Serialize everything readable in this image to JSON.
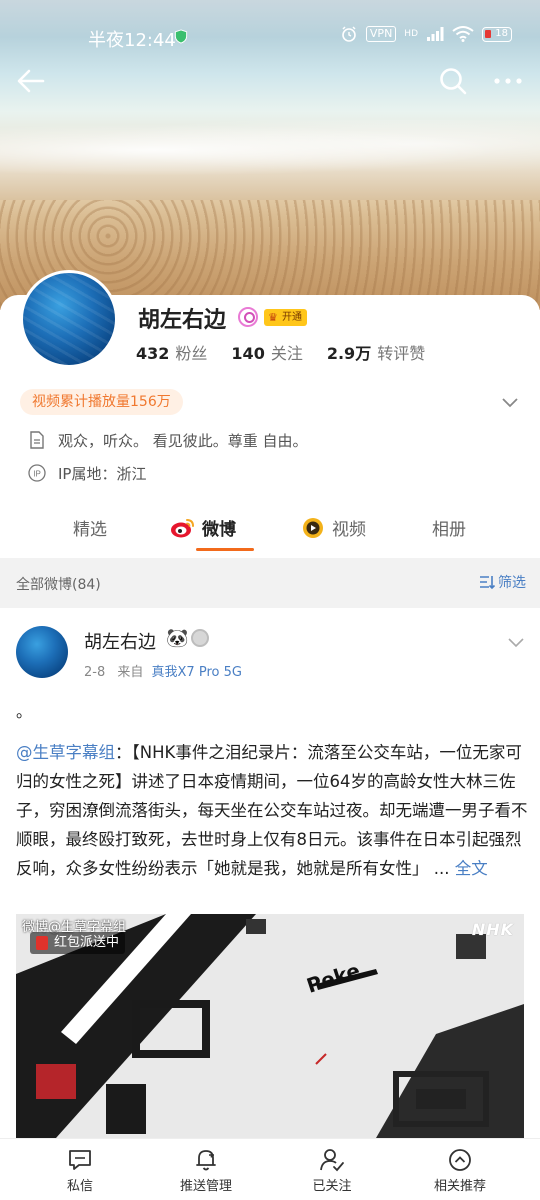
{
  "status": {
    "time": "半夜12:44",
    "vpn": "VPN",
    "network": "HD",
    "battery": "18"
  },
  "profile": {
    "name": "胡左右边",
    "vip_label": "开通",
    "stats": [
      {
        "num": "432",
        "label": "粉丝"
      },
      {
        "num": "140",
        "label": "关注"
      },
      {
        "num": "2.9万",
        "label": "转评赞"
      }
    ],
    "video_plays": "视频累计播放量156万",
    "bio": "观众，听众。 看见彼此。尊重 自由。",
    "ip_location": "IP属地：浙江"
  },
  "tabs": [
    {
      "label": "精选"
    },
    {
      "label": "微博"
    },
    {
      "label": "视频"
    },
    {
      "label": "相册"
    }
  ],
  "section": {
    "label": "全部微博(84)",
    "filter": "筛选"
  },
  "post": {
    "author": "胡左右边",
    "emoji": "🐼",
    "date": "2-8",
    "from_label": "来自",
    "device": "真我X7 Pro 5G",
    "content_dot": "。",
    "mention": "@生草字幕组",
    "body": "：【NHK事件之泪纪录片：流落至公交车站，一位无家可归的女性之死】讲述了日本疫情期间，一位64岁的高龄女性大林三佐子，穷困潦倒流落街头，每天坐在公交车站过夜。却无端遭一男子看不顺眼，最终殴打致死，去世时身上仅有8日元。该事件在日本引起强烈反响，众多女性纷纷表示「她就是我，她就是所有女性」 ...",
    "full_text": "全文",
    "media_watermark": "微博@生草字幕组",
    "media_redpack": "红包派送中",
    "media_brand": "NHK",
    "media_text": "Peke"
  },
  "bottom": [
    {
      "label": "私信"
    },
    {
      "label": "推送管理"
    },
    {
      "label": "已关注"
    },
    {
      "label": "相关推荐"
    }
  ],
  "colors": {
    "accent": "#f26a1b",
    "link": "#4a7fc4",
    "vip": "#ffc61a"
  }
}
